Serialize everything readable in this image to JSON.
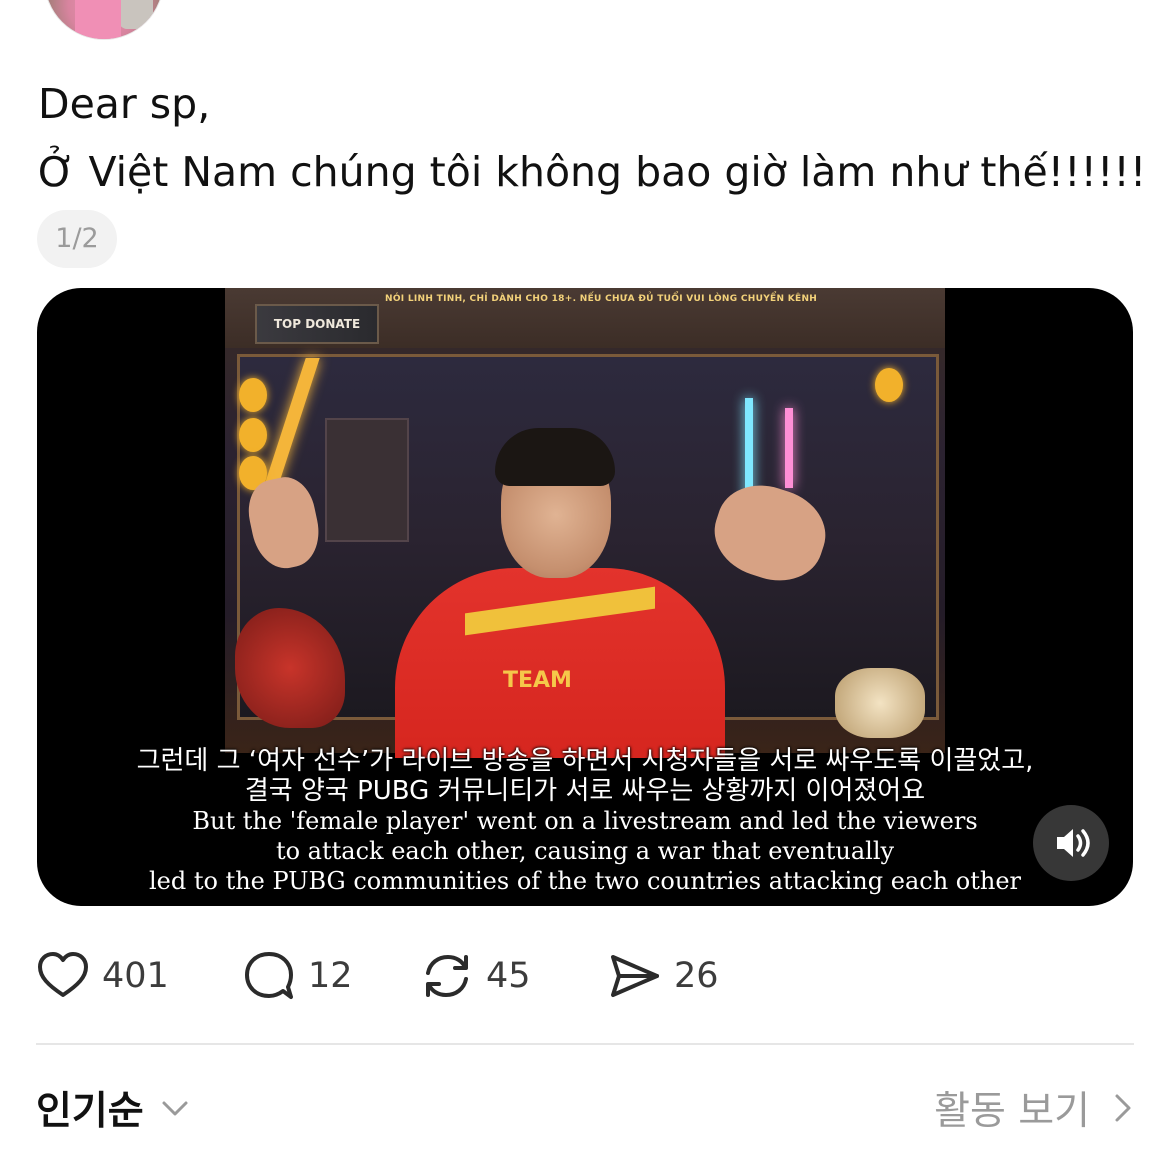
{
  "post": {
    "line1": "Dear sp,",
    "line2": "Ở Việt Nam chúng tôi không bao giờ làm như thế!!!!!!",
    "media_counter": "1/2"
  },
  "video": {
    "overlay": {
      "banner": "NÓI LINH TINH, CHỈ DÀNH CHO 18+. NẾU CHƯA ĐỦ TUỔI VUI LÒNG CHUYỂN KÊNH",
      "top_donate": "TOP DONATE",
      "shirt_text": "TEAM"
    },
    "subtitles": {
      "ko_line1": "그런데 그 ‘여자 선수’가 라이브 방송을 하면서 시청자들을 서로 싸우도록 이끌었고,",
      "ko_line2": "결국 양국 PUBG 커뮤니티가 서로 싸우는 상황까지 이어졌어요",
      "en_line1": "But the 'female player' went on a livestream and led the viewers",
      "en_line2": "to attack each other, causing a war that eventually",
      "en_line3": "led to the PUBG communities of the two countries attacking each other"
    },
    "sound_icon": "speaker-icon"
  },
  "actions": {
    "like": {
      "icon": "heart-icon",
      "count": "401"
    },
    "comment": {
      "icon": "comment-icon",
      "count": "12"
    },
    "repost": {
      "icon": "repost-icon",
      "count": "45"
    },
    "share": {
      "icon": "send-icon",
      "count": "26"
    }
  },
  "footer": {
    "sort_label": "인기순",
    "sort_icon": "chevron-down-icon",
    "activity_label": "활동 보기",
    "activity_icon": "chevron-right-icon"
  }
}
